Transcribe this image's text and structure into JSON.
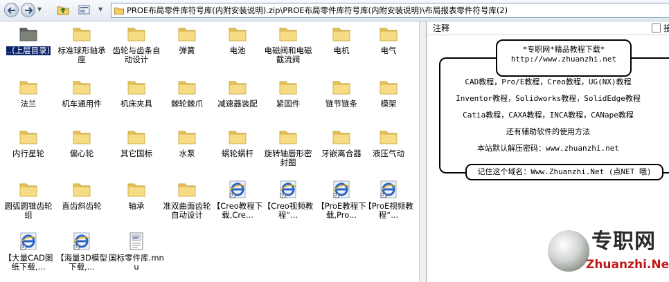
{
  "address": {
    "path": "PROE布局零件库符号库(内附安装说明).zip\\PROE布局零件库符号库(内附安装说明)\\布局报表零件符号库(2)"
  },
  "files": [
    {
      "label": "..(上层目录)",
      "icon": "up-folder-icon",
      "selected": true
    },
    {
      "label": "标准球形轴承座",
      "icon": "folder-icon"
    },
    {
      "label": "齿轮与齿条自动设计",
      "icon": "folder-icon"
    },
    {
      "label": "弹簧",
      "icon": "folder-icon"
    },
    {
      "label": "电池",
      "icon": "folder-icon"
    },
    {
      "label": "电磁阀和电磁截流阀",
      "icon": "folder-icon"
    },
    {
      "label": "电机",
      "icon": "folder-icon"
    },
    {
      "label": "电气",
      "icon": "folder-icon"
    },
    {
      "label": "法兰",
      "icon": "folder-icon"
    },
    {
      "label": "机车通用件",
      "icon": "folder-icon"
    },
    {
      "label": "机床夹具",
      "icon": "folder-icon"
    },
    {
      "label": "棘轮棘爪",
      "icon": "folder-icon"
    },
    {
      "label": "减速器装配",
      "icon": "folder-icon"
    },
    {
      "label": "紧固件",
      "icon": "folder-icon"
    },
    {
      "label": "链节链条",
      "icon": "folder-icon"
    },
    {
      "label": "模架",
      "icon": "folder-icon"
    },
    {
      "label": "内行星轮",
      "icon": "folder-icon"
    },
    {
      "label": "偏心轮",
      "icon": "folder-icon"
    },
    {
      "label": "其它国标",
      "icon": "folder-icon"
    },
    {
      "label": "水泵",
      "icon": "folder-icon"
    },
    {
      "label": "蜗轮蜗杆",
      "icon": "folder-icon"
    },
    {
      "label": "旋转轴唇形密封圈",
      "icon": "folder-icon"
    },
    {
      "label": "牙嵌离合器",
      "icon": "folder-icon"
    },
    {
      "label": "液压气动",
      "icon": "folder-icon"
    },
    {
      "label": "圆弧圆锥齿轮组",
      "icon": "folder-icon"
    },
    {
      "label": "直齿斜齿轮",
      "icon": "folder-icon"
    },
    {
      "label": "轴承",
      "icon": "folder-icon"
    },
    {
      "label": "准双曲面齿轮自动设计",
      "icon": "folder-icon"
    },
    {
      "label": "【Creo教程下载,Cre...",
      "icon": "internet-shortcut-icon"
    },
    {
      "label": "【Creo视频教程“...",
      "icon": "internet-shortcut-icon"
    },
    {
      "label": "【ProE教程下载,Pro...",
      "icon": "internet-shortcut-icon"
    },
    {
      "label": "【ProE视频教程“...",
      "icon": "internet-shortcut-icon"
    },
    {
      "label": "【大量CAD图纸下载,...",
      "icon": "internet-shortcut-icon"
    },
    {
      "label": "【海量3D模型下载,...",
      "icon": "internet-shortcut-icon"
    },
    {
      "label": "国标零件库.mnu",
      "icon": "mnu-file-icon"
    }
  ],
  "comment": {
    "header": "注释",
    "checkbox_label": "接",
    "title_line1": "*专职网*精品教程下载*",
    "title_line2": "http://www.zhuanzhi.net",
    "lines": [
      "CAD教程，Pro/E教程，Creo教程，UG(NX)教程",
      "Inventor教程，Solidworks教程，SolidEdge教程",
      "Catia教程，CAXA教程，INCA教程，CANape教程",
      "还有辅助软件的使用方法",
      "本站默认解压密码：www.zhuanzhi.net"
    ],
    "domain_note": "记住这个域名：Www.Zhuanzhi.Net (点NET 哦)",
    "logo_text": "专职网",
    "logo_url": "Zhuanzhi.Net"
  },
  "colors": {
    "selection": "#0a246a",
    "folder": "#f5d77a",
    "logo_red": "#c01818"
  }
}
